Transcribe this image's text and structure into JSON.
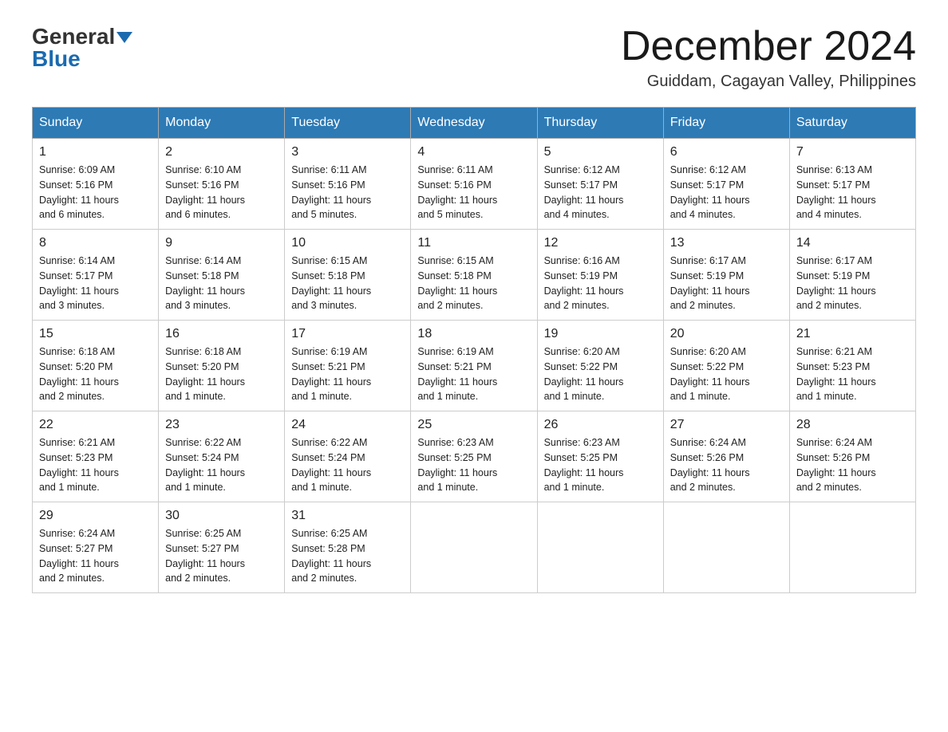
{
  "header": {
    "logo_general": "General",
    "logo_blue": "Blue",
    "month_title": "December 2024",
    "location": "Guiddam, Cagayan Valley, Philippines"
  },
  "days_of_week": [
    "Sunday",
    "Monday",
    "Tuesday",
    "Wednesday",
    "Thursday",
    "Friday",
    "Saturday"
  ],
  "weeks": [
    [
      {
        "day": "1",
        "sunrise": "6:09 AM",
        "sunset": "5:16 PM",
        "daylight": "11 hours and 6 minutes."
      },
      {
        "day": "2",
        "sunrise": "6:10 AM",
        "sunset": "5:16 PM",
        "daylight": "11 hours and 6 minutes."
      },
      {
        "day": "3",
        "sunrise": "6:11 AM",
        "sunset": "5:16 PM",
        "daylight": "11 hours and 5 minutes."
      },
      {
        "day": "4",
        "sunrise": "6:11 AM",
        "sunset": "5:16 PM",
        "daylight": "11 hours and 5 minutes."
      },
      {
        "day": "5",
        "sunrise": "6:12 AM",
        "sunset": "5:17 PM",
        "daylight": "11 hours and 4 minutes."
      },
      {
        "day": "6",
        "sunrise": "6:12 AM",
        "sunset": "5:17 PM",
        "daylight": "11 hours and 4 minutes."
      },
      {
        "day": "7",
        "sunrise": "6:13 AM",
        "sunset": "5:17 PM",
        "daylight": "11 hours and 4 minutes."
      }
    ],
    [
      {
        "day": "8",
        "sunrise": "6:14 AM",
        "sunset": "5:17 PM",
        "daylight": "11 hours and 3 minutes."
      },
      {
        "day": "9",
        "sunrise": "6:14 AM",
        "sunset": "5:18 PM",
        "daylight": "11 hours and 3 minutes."
      },
      {
        "day": "10",
        "sunrise": "6:15 AM",
        "sunset": "5:18 PM",
        "daylight": "11 hours and 3 minutes."
      },
      {
        "day": "11",
        "sunrise": "6:15 AM",
        "sunset": "5:18 PM",
        "daylight": "11 hours and 2 minutes."
      },
      {
        "day": "12",
        "sunrise": "6:16 AM",
        "sunset": "5:19 PM",
        "daylight": "11 hours and 2 minutes."
      },
      {
        "day": "13",
        "sunrise": "6:17 AM",
        "sunset": "5:19 PM",
        "daylight": "11 hours and 2 minutes."
      },
      {
        "day": "14",
        "sunrise": "6:17 AM",
        "sunset": "5:19 PM",
        "daylight": "11 hours and 2 minutes."
      }
    ],
    [
      {
        "day": "15",
        "sunrise": "6:18 AM",
        "sunset": "5:20 PM",
        "daylight": "11 hours and 2 minutes."
      },
      {
        "day": "16",
        "sunrise": "6:18 AM",
        "sunset": "5:20 PM",
        "daylight": "11 hours and 1 minute."
      },
      {
        "day": "17",
        "sunrise": "6:19 AM",
        "sunset": "5:21 PM",
        "daylight": "11 hours and 1 minute."
      },
      {
        "day": "18",
        "sunrise": "6:19 AM",
        "sunset": "5:21 PM",
        "daylight": "11 hours and 1 minute."
      },
      {
        "day": "19",
        "sunrise": "6:20 AM",
        "sunset": "5:22 PM",
        "daylight": "11 hours and 1 minute."
      },
      {
        "day": "20",
        "sunrise": "6:20 AM",
        "sunset": "5:22 PM",
        "daylight": "11 hours and 1 minute."
      },
      {
        "day": "21",
        "sunrise": "6:21 AM",
        "sunset": "5:23 PM",
        "daylight": "11 hours and 1 minute."
      }
    ],
    [
      {
        "day": "22",
        "sunrise": "6:21 AM",
        "sunset": "5:23 PM",
        "daylight": "11 hours and 1 minute."
      },
      {
        "day": "23",
        "sunrise": "6:22 AM",
        "sunset": "5:24 PM",
        "daylight": "11 hours and 1 minute."
      },
      {
        "day": "24",
        "sunrise": "6:22 AM",
        "sunset": "5:24 PM",
        "daylight": "11 hours and 1 minute."
      },
      {
        "day": "25",
        "sunrise": "6:23 AM",
        "sunset": "5:25 PM",
        "daylight": "11 hours and 1 minute."
      },
      {
        "day": "26",
        "sunrise": "6:23 AM",
        "sunset": "5:25 PM",
        "daylight": "11 hours and 1 minute."
      },
      {
        "day": "27",
        "sunrise": "6:24 AM",
        "sunset": "5:26 PM",
        "daylight": "11 hours and 2 minutes."
      },
      {
        "day": "28",
        "sunrise": "6:24 AM",
        "sunset": "5:26 PM",
        "daylight": "11 hours and 2 minutes."
      }
    ],
    [
      {
        "day": "29",
        "sunrise": "6:24 AM",
        "sunset": "5:27 PM",
        "daylight": "11 hours and 2 minutes."
      },
      {
        "day": "30",
        "sunrise": "6:25 AM",
        "sunset": "5:27 PM",
        "daylight": "11 hours and 2 minutes."
      },
      {
        "day": "31",
        "sunrise": "6:25 AM",
        "sunset": "5:28 PM",
        "daylight": "11 hours and 2 minutes."
      },
      null,
      null,
      null,
      null
    ]
  ],
  "labels": {
    "sunrise": "Sunrise:",
    "sunset": "Sunset:",
    "daylight": "Daylight:"
  }
}
